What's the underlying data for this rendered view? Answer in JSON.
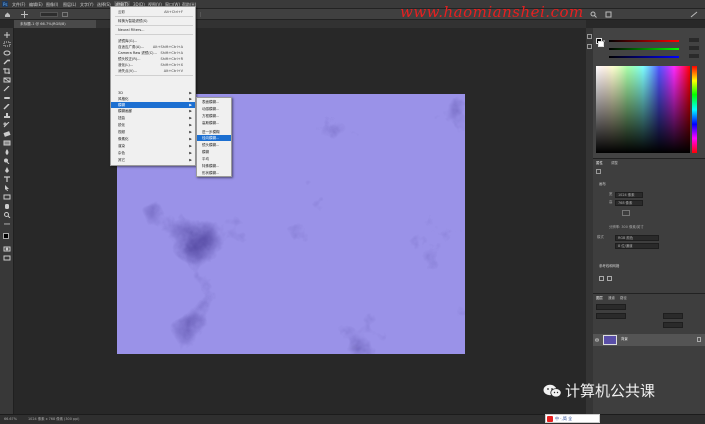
{
  "menubar": {
    "items": [
      "文件(F)",
      "编辑(E)",
      "图像(I)",
      "图层(L)",
      "文字(Y)",
      "选择(S)",
      "滤镜(T)",
      "3D(D)",
      "视图(V)",
      "窗口(W)",
      "帮助(H)"
    ]
  },
  "document_tab": "未标题-1 @ 66.7%(RGB/8)",
  "filter_menu": {
    "items": [
      {
        "label": "云彩",
        "shortcut": "Alt+Ctrl+F"
      },
      {
        "label": "转换为智能滤镜(S)",
        "shortcut": ""
      },
      {
        "label": "Neural Filters...",
        "shortcut": ""
      },
      {
        "label": "滤镜库(G)...",
        "shortcut": ""
      },
      {
        "label": "自适应广角(A)...",
        "shortcut": "Alt+Shift+Ctrl+A"
      },
      {
        "label": "Camera Raw 滤镜(C)...",
        "shortcut": "Shift+Ctrl+A"
      },
      {
        "label": "镜头校正(R)...",
        "shortcut": "Shift+Ctrl+R"
      },
      {
        "label": "液化(L)...",
        "shortcut": "Shift+Ctrl+X"
      },
      {
        "label": "消失点(V)...",
        "shortcut": "Alt+Ctrl+V"
      },
      {
        "label": "3D",
        "submenu": true
      },
      {
        "label": "风格化",
        "submenu": true
      },
      {
        "label": "模糊",
        "submenu": true,
        "highlighted": true
      },
      {
        "label": "模糊画廊",
        "submenu": true
      },
      {
        "label": "扭曲",
        "submenu": true
      },
      {
        "label": "锐化",
        "submenu": true
      },
      {
        "label": "视频",
        "submenu": true
      },
      {
        "label": "像素化",
        "submenu": true
      },
      {
        "label": "渲染",
        "submenu": true
      },
      {
        "label": "杂色",
        "submenu": true
      },
      {
        "label": "其它",
        "submenu": true
      }
    ]
  },
  "blur_submenu": {
    "items": [
      {
        "label": "表面模糊..."
      },
      {
        "label": "动感模糊..."
      },
      {
        "label": "方框模糊..."
      },
      {
        "label": "高斯模糊..."
      },
      {
        "label": "进一步模糊"
      },
      {
        "label": "径向模糊...",
        "highlighted": true
      },
      {
        "label": "镜头模糊..."
      },
      {
        "label": "模糊"
      },
      {
        "label": "平均"
      },
      {
        "label": "特殊模糊..."
      },
      {
        "label": "形状模糊..."
      }
    ]
  },
  "properties_panel": {
    "tabs": [
      "属性",
      "调整"
    ],
    "section": "画布",
    "fields": [
      "1024 像素",
      "768 像素",
      "RGB 颜色",
      "8 位/通道"
    ],
    "labels": [
      "宽",
      "高",
      "分辨率: 300 像素/英寸",
      "模式"
    ],
    "footer": "参考线和网格"
  },
  "layers_panel": {
    "tabs": [
      "图层",
      "通道",
      "路径"
    ],
    "layer_name": "背景"
  },
  "status": {
    "zoom": "66.67%",
    "doc_info": "1024 像素 x 768 像素 (300 ppi)"
  },
  "ime": "中 ·,简 全",
  "watermark": "www.haomianshei.com",
  "wechat_label": "计算机公共课",
  "colors": {
    "canvas_base": "#5a4fa8",
    "highlight": "#1c6fd1",
    "watermark": "#e62020"
  }
}
